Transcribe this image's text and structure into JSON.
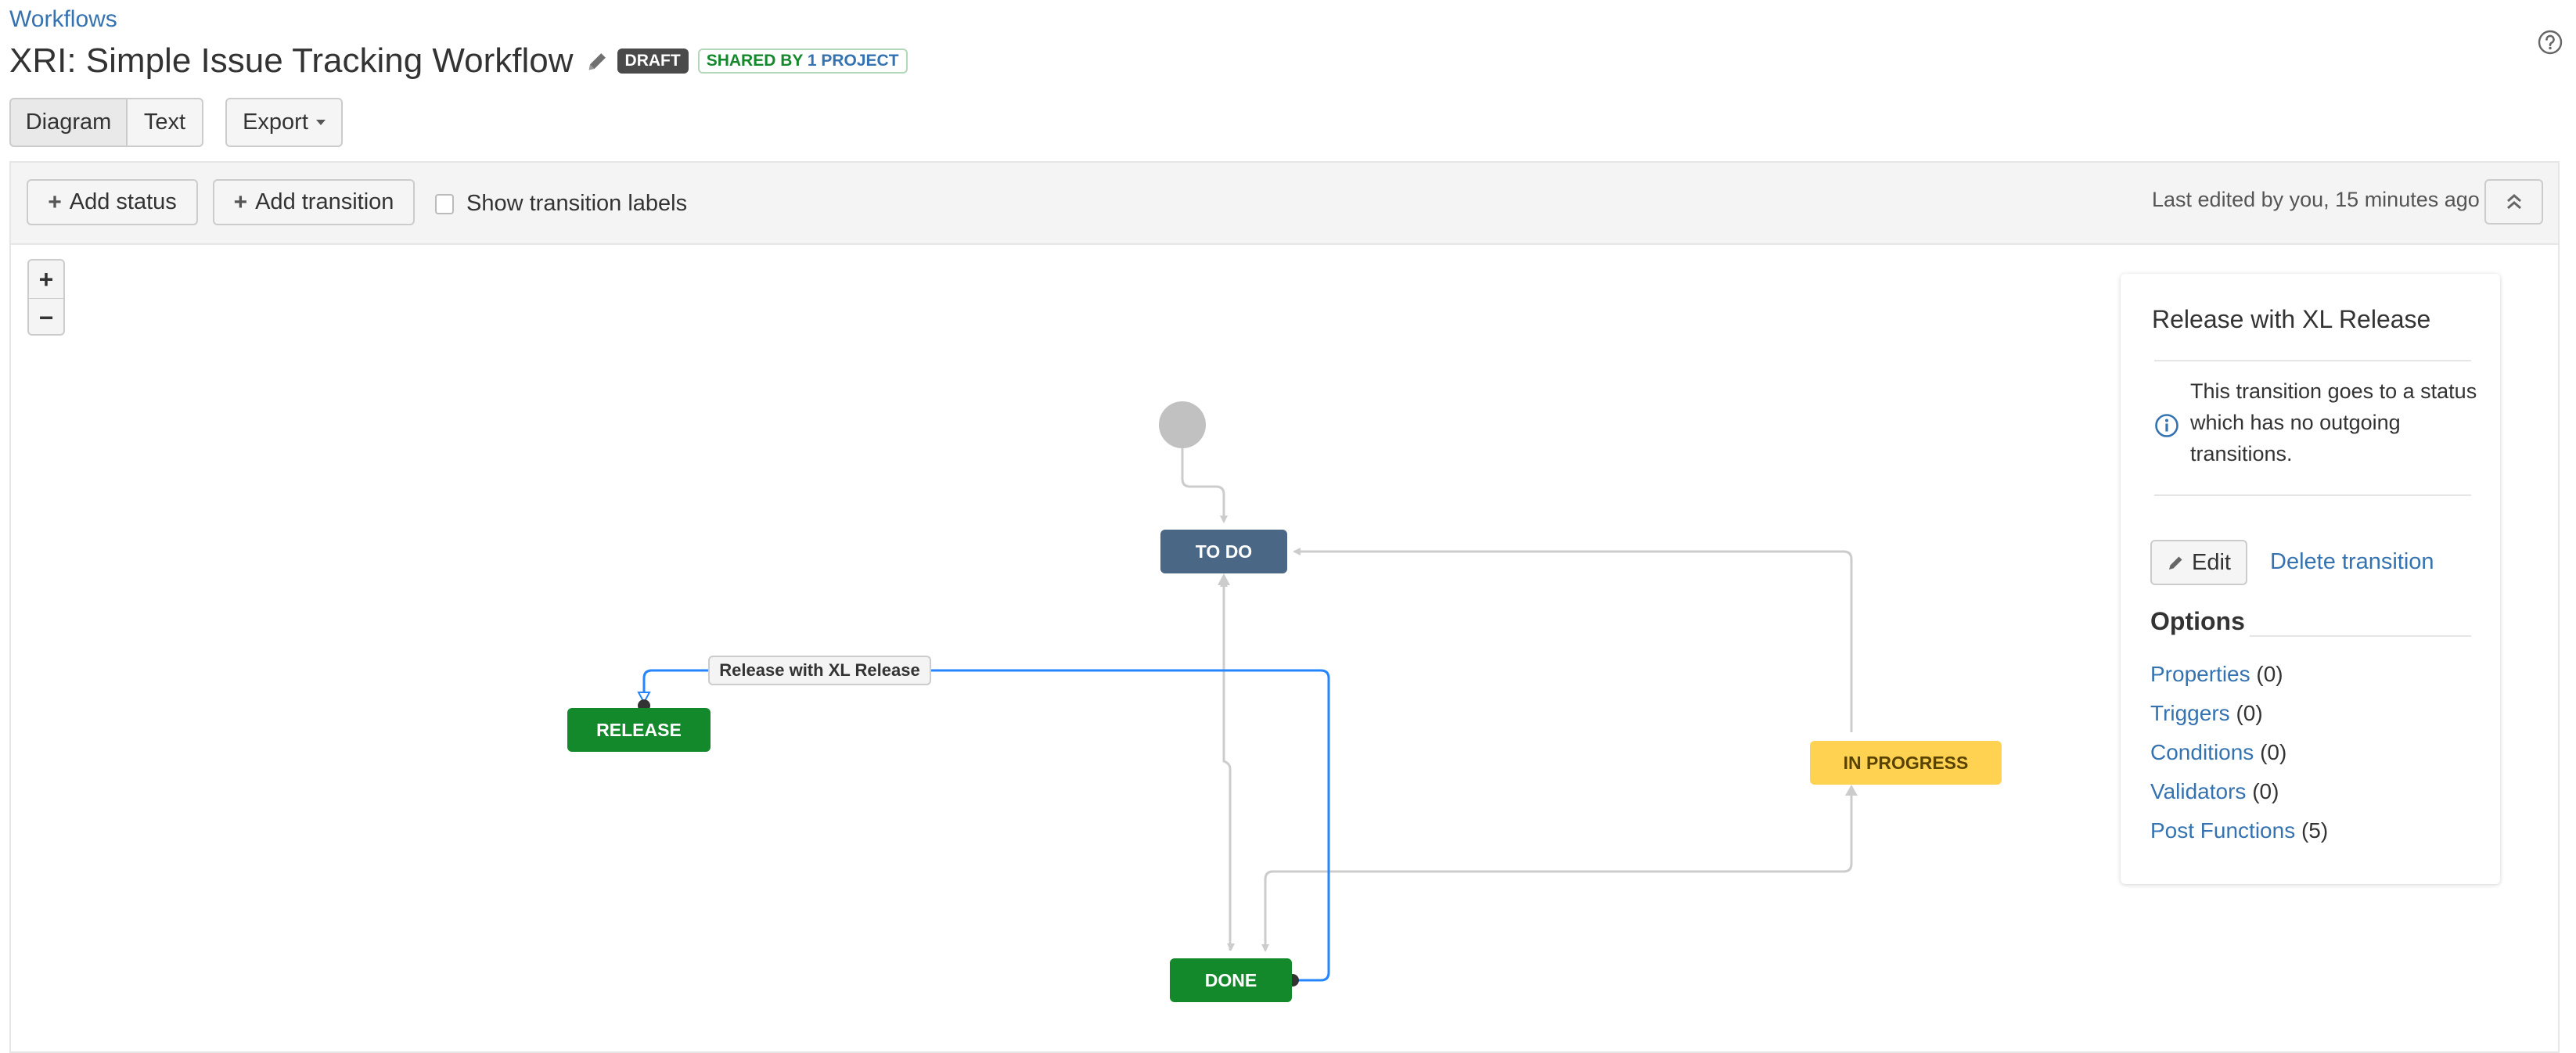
{
  "breadcrumb": {
    "label": "Workflows"
  },
  "header": {
    "title": "XRI: Simple Issue Tracking Workflow",
    "draft_badge": "DRAFT",
    "shared_badge_prefix": "SHARED BY",
    "shared_badge_count": "1 PROJECT",
    "help_icon": "help-icon"
  },
  "view_tabs": [
    {
      "label": "Diagram",
      "selected": true
    },
    {
      "label": "Text",
      "selected": false
    }
  ],
  "export_button": {
    "label": "Export"
  },
  "toolbar": {
    "add_status": "Add status",
    "add_transition": "Add transition",
    "show_labels": "Show transition labels",
    "show_labels_checked": false,
    "last_edited": "Last edited by you, 15 minutes ago"
  },
  "zoom": {
    "in": "+",
    "out": "−"
  },
  "diagram": {
    "statuses": [
      {
        "id": "todo",
        "label": "TO DO",
        "color": "#4a6785"
      },
      {
        "id": "release",
        "label": "RELEASE",
        "color": "#14892c"
      },
      {
        "id": "done",
        "label": "DONE",
        "color": "#14892c"
      },
      {
        "id": "inprogress",
        "label": "IN PROGRESS",
        "color": "#ffd351"
      }
    ],
    "transitions": [
      {
        "from": "start",
        "to": "todo"
      },
      {
        "from": "inprogress",
        "to": "todo"
      },
      {
        "from": "todo",
        "to": "inprogress"
      },
      {
        "from": "done",
        "to": "todo"
      },
      {
        "from": "todo",
        "to": "done"
      },
      {
        "from": "done",
        "to": "inprogress"
      },
      {
        "from": "inprogress",
        "to": "done"
      },
      {
        "from": "done",
        "to": "release",
        "label": "Release with XL Release",
        "selected": true
      }
    ],
    "selected_transition_label": "Release with XL Release",
    "selected_color": "#2684ff",
    "line_color": "#cccccc"
  },
  "panel": {
    "title": "Release with XL Release",
    "info": "This transition goes to a status which has no outgoing transitions.",
    "edit_label": "Edit",
    "delete_label": "Delete transition",
    "options_heading": "Options",
    "options": [
      {
        "label": "Properties",
        "count": "(0)"
      },
      {
        "label": "Triggers",
        "count": "(0)"
      },
      {
        "label": "Conditions",
        "count": "(0)"
      },
      {
        "label": "Validators",
        "count": "(0)"
      },
      {
        "label": "Post Functions",
        "count": "(5)"
      }
    ]
  }
}
